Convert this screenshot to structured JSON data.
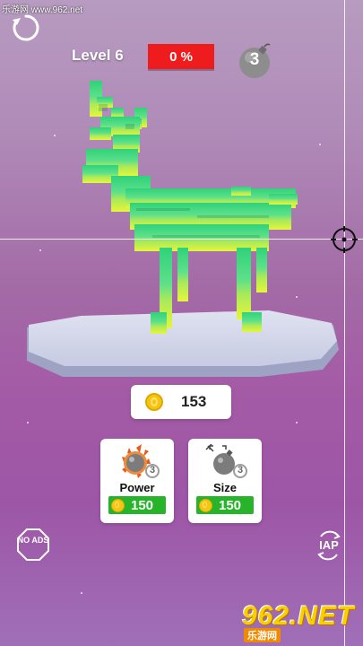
{
  "watermark_top": "乐游网 www.962.net",
  "hud": {
    "level_label": "Level 6",
    "progress_text": "0 %",
    "progress_percent": 0,
    "bombs_left": "3",
    "restart_icon": "restart-icon",
    "bomb_icon": "bomb-icon"
  },
  "coins": {
    "amount": "153",
    "icon": "coin-icon"
  },
  "upgrades": [
    {
      "title": "Power",
      "level": "3",
      "price": "150",
      "icon": "fire-ball-icon"
    },
    {
      "title": "Size",
      "level": "3",
      "price": "150",
      "icon": "bomb-size-icon"
    }
  ],
  "buttons": {
    "no_ads": "NO ADS",
    "iap": "IAP"
  },
  "brand": {
    "main": "962.NET",
    "sub": "乐游网"
  },
  "colors": {
    "progress_red": "#ee1c1c",
    "price_green": "#27b32a",
    "coin_gold": "#f5c515",
    "deer_top": "#2fd27a",
    "deer_bottom": "#e6f53a"
  }
}
